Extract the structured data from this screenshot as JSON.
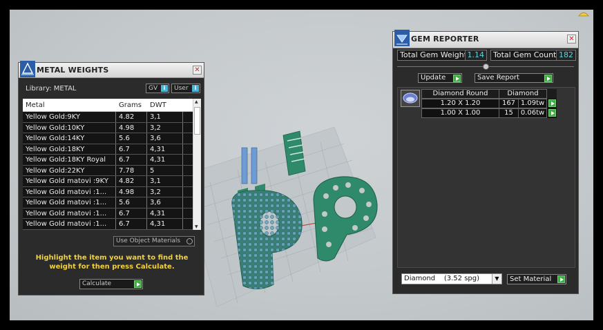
{
  "metal_panel": {
    "title": "METAL WEIGHTS",
    "library_label": "Library: METAL",
    "toggle_gv": "GV",
    "toggle_user": "User",
    "info_glyph": "i",
    "columns": [
      "Metal",
      "Grams",
      "DWT"
    ],
    "rows": [
      {
        "metal": "Yellow Gold:9KY",
        "grams": "4.82",
        "dwt": "3,1"
      },
      {
        "metal": "Yellow Gold:10KY",
        "grams": "4.98",
        "dwt": "3,2"
      },
      {
        "metal": "Yellow Gold:14KY",
        "grams": "5.6",
        "dwt": "3,6"
      },
      {
        "metal": "Yellow Gold:18KY",
        "grams": "6.7",
        "dwt": "4,31"
      },
      {
        "metal": "Yellow Gold:18KY Royal",
        "grams": "6.7",
        "dwt": "4,31"
      },
      {
        "metal": "Yellow Gold:22KY",
        "grams": "7.78",
        "dwt": "5"
      },
      {
        "metal": "Yellow Gold matovi :9KY",
        "grams": "4.82",
        "dwt": "3,1"
      },
      {
        "metal": "Yellow Gold matovi :1...",
        "grams": "4.98",
        "dwt": "3,2"
      },
      {
        "metal": "Yellow Gold matovi :1...",
        "grams": "5.6",
        "dwt": "3,6"
      },
      {
        "metal": "Yellow Gold matovi :1...",
        "grams": "6.7",
        "dwt": "4,31"
      },
      {
        "metal": "Yellow Gold matovi :1...",
        "grams": "6.7",
        "dwt": "4,31"
      }
    ],
    "use_object": "Use Object Materials",
    "hint": "Highlight the item you want to find the weight for then press Calculate.",
    "calculate": "Calculate"
  },
  "gem_panel": {
    "title": "GEM REPORTER",
    "total_weight_label": "Total Gem Weight",
    "total_weight_value": "1.14",
    "total_count_label": "Total Gem Count",
    "total_count_value": "182",
    "update": "Update",
    "save_report": "Save Report",
    "table_header": {
      "shape": "Diamond Round",
      "material": "Diamond"
    },
    "table_rows": [
      {
        "size": "1.20 X 1.20",
        "count": "167",
        "weight": "1.09tw"
      },
      {
        "size": "1.00 X 1.00",
        "count": "15",
        "weight": "0.06tw"
      }
    ],
    "material_select": "Diamond    (3.52 spg)",
    "set_material": "Set Material"
  },
  "colors": {
    "accent_green": "#3cb043",
    "value_cyan": "#5fd5e0",
    "hint_yellow": "#f2d13a",
    "model_green": "#2e8a6a"
  }
}
